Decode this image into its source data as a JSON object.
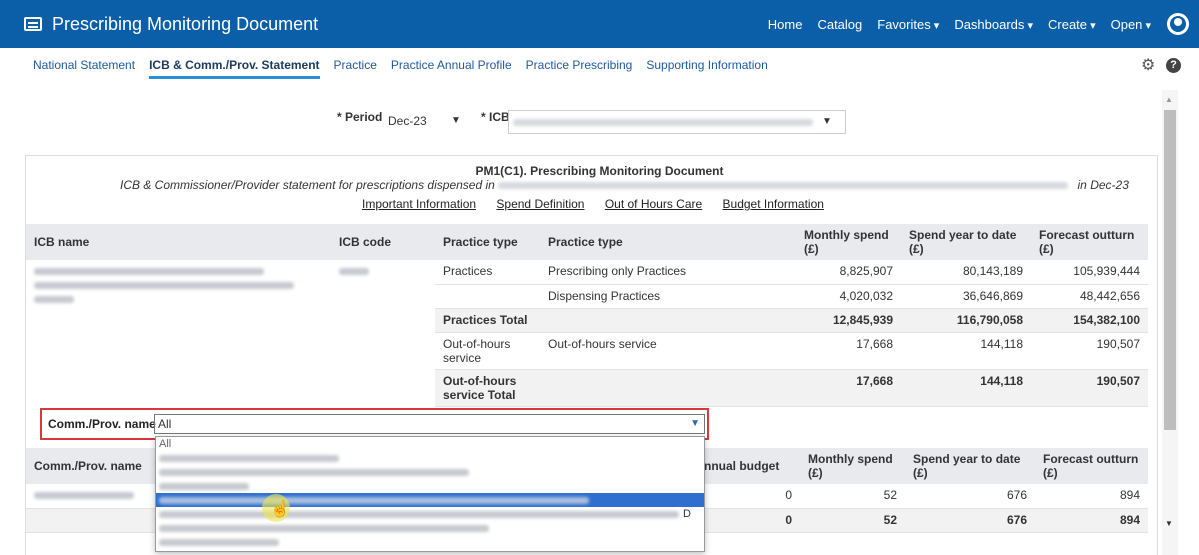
{
  "header": {
    "app_title": "Prescribing Monitoring Document",
    "nav": [
      "Home",
      "Catalog",
      "Favorites",
      "Dashboards",
      "Create",
      "Open"
    ]
  },
  "tabs": [
    {
      "label": "National Statement",
      "active": false
    },
    {
      "label": "ICB & Comm./Prov. Statement",
      "active": true
    },
    {
      "label": "Practice",
      "active": false
    },
    {
      "label": "Practice Annual Profile",
      "active": false
    },
    {
      "label": "Practice Prescribing",
      "active": false
    },
    {
      "label": "Supporting Information",
      "active": false
    }
  ],
  "prompts": {
    "period_label": "* Period",
    "period_value": "Dec-23",
    "icb_label": "* ICB"
  },
  "document": {
    "title": "PM1(C1). Prescribing Monitoring Document",
    "subtitle_prefix": "ICB & Commissioner/Provider statement for prescriptions dispensed in",
    "subtitle_suffix": "in Dec-23",
    "links": [
      "Important Information",
      "Spend Definition",
      "Out of Hours Care",
      "Budget Information"
    ]
  },
  "icb_table": {
    "headers": [
      "ICB name",
      "ICB code",
      "Practice type",
      "Practice type",
      "Monthly spend (£)",
      "Spend year to date (£)",
      "Forecast outturn (£)"
    ],
    "rows": [
      {
        "type": "Practices",
        "subtype": "Prescribing only Practices",
        "monthly": "8,825,907",
        "ytd": "80,143,189",
        "forecast": "105,939,444"
      },
      {
        "type": "",
        "subtype": "Dispensing Practices",
        "monthly": "4,020,032",
        "ytd": "36,646,869",
        "forecast": "48,442,656"
      },
      {
        "type": "Practices Total",
        "subtype": "",
        "monthly": "12,845,939",
        "ytd": "116,790,058",
        "forecast": "154,382,100"
      },
      {
        "type": "Out-of-hours service",
        "subtype": "Out-of-hours service",
        "monthly": "17,668",
        "ytd": "144,118",
        "forecast": "190,507"
      },
      {
        "type": "Out-of-hours service Total",
        "subtype": "",
        "monthly": "17,668",
        "ytd": "144,118",
        "forecast": "190,507"
      }
    ]
  },
  "comm_filter": {
    "label": "Comm./Prov. name",
    "value": "All",
    "option_all": "All",
    "visible_letter": "D"
  },
  "comm_table": {
    "headers": [
      "Comm./Prov. name",
      "nnual budget",
      "Monthly spend (£)",
      "Spend year to date (£)",
      "Forecast outturn (£)"
    ],
    "rows": [
      {
        "budget": "0",
        "monthly": "52",
        "ytd": "676",
        "forecast": "894"
      },
      {
        "budget": "0",
        "monthly": "52",
        "ytd": "676",
        "forecast": "894"
      }
    ]
  }
}
